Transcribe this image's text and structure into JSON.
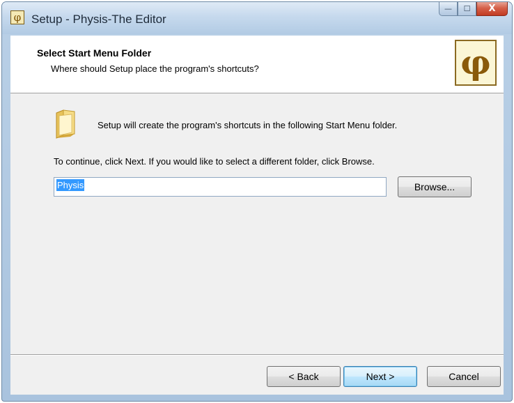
{
  "window": {
    "title": "Setup - Physis-The Editor",
    "app_icon_glyph": "φ",
    "caption": {
      "minimize_glyph": "—",
      "maximize_glyph": "☐",
      "close_glyph": "X"
    }
  },
  "header": {
    "title": "Select Start Menu Folder",
    "subtitle": "Where should Setup place the program's shortcuts?",
    "logo_glyph": "φ"
  },
  "content": {
    "info_text": "Setup will create the program's shortcuts in the following Start Menu folder.",
    "continue_text": "To continue, click Next. If you would like to select a different folder, click Browse.",
    "folder_input_value": "Physis",
    "browse_label": "Browse..."
  },
  "footer": {
    "back_label": "< Back",
    "next_label": "Next >",
    "cancel_label": "Cancel"
  },
  "icons": {
    "folder": "folder-icon",
    "app": "phi-app-icon"
  },
  "colors": {
    "selection": "#3399ff",
    "logo_border": "#8b6a22",
    "default_button_border": "#3c7fb1"
  }
}
